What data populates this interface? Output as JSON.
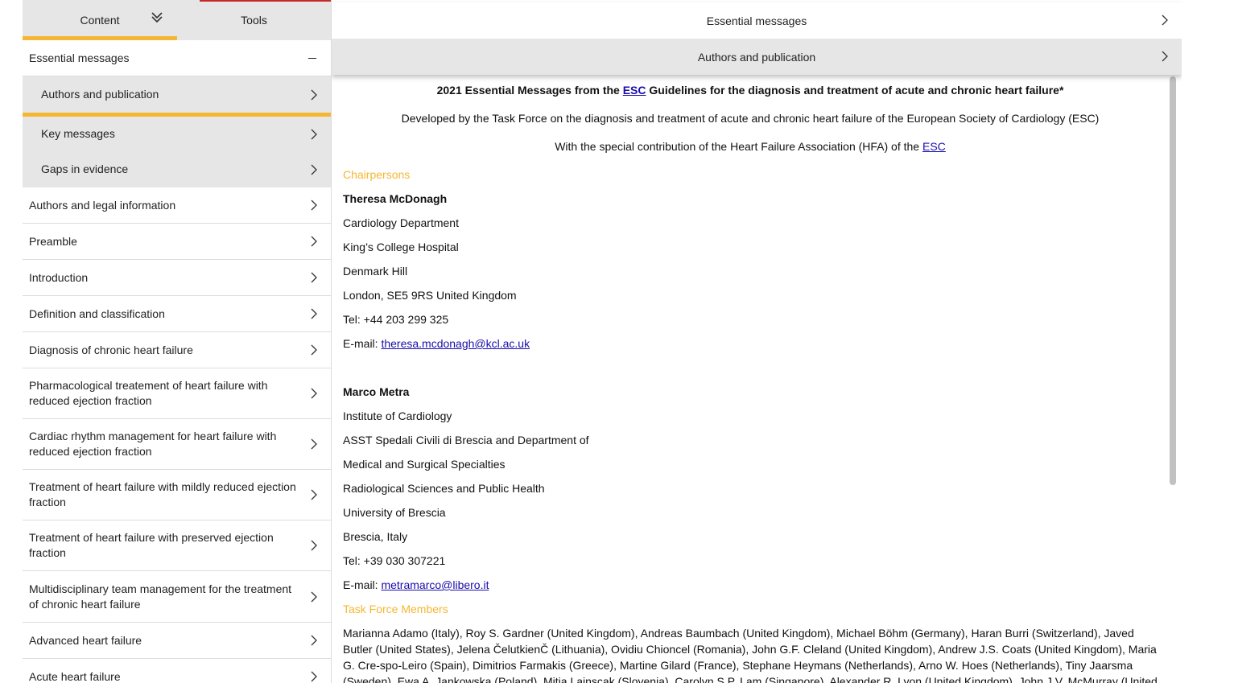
{
  "sidebar": {
    "tabs": {
      "content": "Content",
      "tools": "Tools"
    },
    "items": [
      {
        "label": "Essential messages"
      },
      {
        "label": "Authors and publication"
      },
      {
        "label": "Key messages"
      },
      {
        "label": "Gaps in evidence"
      },
      {
        "label": "Authors and legal information"
      },
      {
        "label": "Preamble"
      },
      {
        "label": "Introduction"
      },
      {
        "label": "Definition and classification"
      },
      {
        "label": "Diagnosis of chronic heart failure"
      },
      {
        "label": "Pharmacological treatement of heart failure with reduced ejection fraction"
      },
      {
        "label": "Cardiac rhythm management for heart failure with reduced ejection fraction"
      },
      {
        "label": "Treatment of heart failure with mildly reduced ejection fraction"
      },
      {
        "label": "Treatment of heart failure with preserved ejection fraction"
      },
      {
        "label": "Multidisciplinary team management for the treatment of chronic heart failure"
      },
      {
        "label": "Advanced heart failure"
      },
      {
        "label": "Acute heart failure"
      }
    ]
  },
  "header": {
    "row1": "Essential messages",
    "row2": "Authors and publication"
  },
  "content": {
    "title_pre": "2021 Essential Messages from the ",
    "title_link": "ESC",
    "title_post": " Guidelines for the diagnosis and treatment of acute and chronic heart failure*",
    "developed": "Developed by the Task Force on the diagnosis and treatment of acute and chronic heart failure of the European Society of Cardiology (ESC)",
    "contribution_pre": "With the special contribution of the Heart Failure Association (HFA) of the ",
    "contribution_link": "ESC",
    "chair_heading": "Chairpersons",
    "chair1": {
      "name": "Theresa McDonagh",
      "lines": [
        "Cardiology Department",
        "King’s College Hospital",
        "Denmark Hill",
        "London, SE5 9RS United Kingdom",
        "Tel: +44 203 299 325"
      ],
      "email_label": "E-mail: ",
      "email": "theresa.mcdonagh@kcl.ac.uk"
    },
    "chair2": {
      "name": "Marco Metra",
      "lines": [
        "Institute of Cardiology",
        "ASST Spedali Civili di Brescia and Department of",
        "Medical and Surgical Specialties",
        "Radiological Sciences and Public Health",
        "University of Brescia",
        "Brescia, Italy",
        "Tel: +39 030 307221"
      ],
      "email_label": "E-mail: ",
      "email": "metramarco@libero.it"
    },
    "members_heading": "Task Force Members",
    "members": "Marianna Adamo (Italy), Roy S. Gardner (United Kingdom), Andreas Baumbach (United Kingdom), Michael Böhm (Germany), Haran Burri (Switzerland), Javed Butler (United States), Jelena ČelutkienČ (Lithuania), Ovidiu Chioncel (Romania), John G.F. Cleland (United Kingdom), Andrew J.S. Coats (United Kingdom), Maria G. Cre-spo-Leiro (Spain), Dimitrios Farmakis (Greece), Martine Gilard (France), Stephane Heymans (Netherlands), Arno W. Hoes (Netherlands), Tiny Jaarsma (Sweden), Ewa A. Jankowska (Poland), Mitja Lainscak (Slovenia), Carolyn S.P. Lam (Singapore), Alexander R. Lyon (United Kingdom), John J.V. McMurray (United Kingdom)"
  },
  "colors": {
    "accent": "#f5b731",
    "top_red": "#c62828",
    "grey_bg": "#e6e6e6",
    "link": "#1a0dab"
  }
}
